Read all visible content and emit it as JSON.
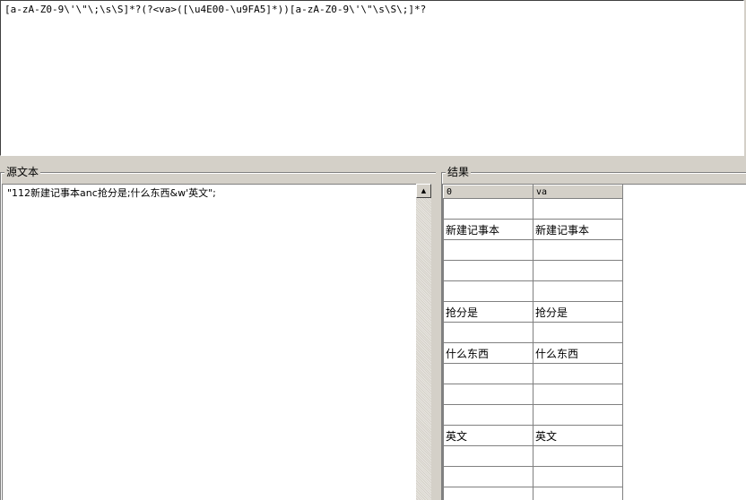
{
  "regex": "[a-zA-Z0-9\\'\\\"\\;\\s\\S]*?(?<va>([\\u4E00-\\u9FA5]*))[a-zA-Z0-9\\'\\\"\\s\\S\\;]*?",
  "source": {
    "legend": "源文本",
    "text": "\"112新建记事本anc抢分是;什么东西&w'英文\";"
  },
  "results": {
    "legend": "结果",
    "columns": [
      "0",
      "va"
    ],
    "rows": [
      [
        "",
        ""
      ],
      [
        "新建记事本",
        "新建记事本"
      ],
      [
        "",
        ""
      ],
      [
        "",
        ""
      ],
      [
        "",
        ""
      ],
      [
        "抢分是",
        "抢分是"
      ],
      [
        "",
        ""
      ],
      [
        "什么东西",
        "什么东西"
      ],
      [
        "",
        ""
      ],
      [
        "",
        ""
      ],
      [
        "",
        ""
      ],
      [
        "英文",
        "英文"
      ],
      [
        "",
        ""
      ],
      [
        "",
        ""
      ],
      [
        "",
        ""
      ]
    ]
  },
  "icons": {
    "scroll_up": "up-arrow-icon"
  }
}
